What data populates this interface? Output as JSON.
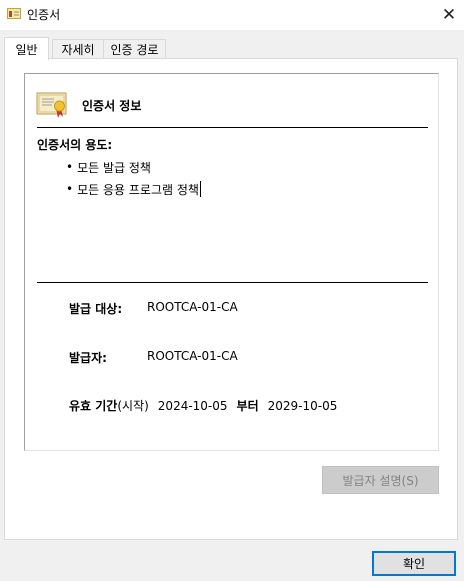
{
  "window": {
    "title": "인증서",
    "icon": "certificate-icon"
  },
  "tabs": [
    {
      "label": "일반",
      "active": true
    },
    {
      "label": "자세히",
      "active": false
    },
    {
      "label": "인증 경로",
      "active": false
    }
  ],
  "info": {
    "title": "인증서 정보",
    "icon": "certificate-ribbon-icon",
    "purposes_label": "인증서의 용도:",
    "purposes": [
      "모든 발급 정책",
      "모든 응용 프로그램 정책"
    ],
    "issued_to_label": "발급 대상:",
    "issued_to_value": "ROOTCA-01-CA",
    "issued_by_label": "발급자:",
    "issued_by_value": "ROOTCA-01-CA",
    "validity_label": "유효 기간",
    "validity_start_label": "(시작)",
    "valid_from": "2024-10-05",
    "validity_to_label": "부터",
    "valid_to": "2029-10-05"
  },
  "buttons": {
    "issuer_statement": "발급자 설명(S)",
    "issuer_statement_enabled": false,
    "ok": "확인"
  },
  "colors": {
    "accent": "#0078d7",
    "disabled_button_bg": "#cccccc",
    "disabled_text": "#838383"
  }
}
